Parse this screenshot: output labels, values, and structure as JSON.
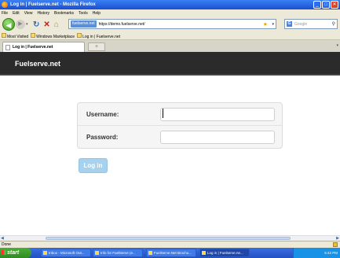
{
  "window": {
    "title": "Log in | Fuelserve.net - Mozilla Firefox",
    "minimize": "_",
    "maximize": "□",
    "close": "✕"
  },
  "menu": [
    "File",
    "Edit",
    "View",
    "History",
    "Bookmarks",
    "Tools",
    "Help"
  ],
  "navbar": {
    "site_identity": "fuelserve.net",
    "url": "https://demo.fuelserve.net/",
    "search_placeholder": "Google"
  },
  "bookmarks": [
    "Most Visited",
    "Windows Marketplace",
    "Log in | Fuelserve.net"
  ],
  "tab": {
    "label": "Log in | Fuelserve.net",
    "new_tab": "+"
  },
  "header": {
    "brand": "Fuelserve.net"
  },
  "login": {
    "username_label": "Username:",
    "username_value": "",
    "password_label": "Password:",
    "password_value": "",
    "submit_label": "Log in"
  },
  "status": {
    "text": "Done"
  },
  "taskbar": {
    "start": "start",
    "tasks": [
      "Inbox - Microsoft Out...",
      "Info for FuelServe (e...",
      "FuelServe.Net Brochu...",
      "Log in | Fuelserve.ne..."
    ],
    "clock": "5:42 PM"
  },
  "colors": {
    "header_bg": "#2b2b2b",
    "login_button": "#a7d2ee",
    "titlebar": "#1a4fd0"
  }
}
